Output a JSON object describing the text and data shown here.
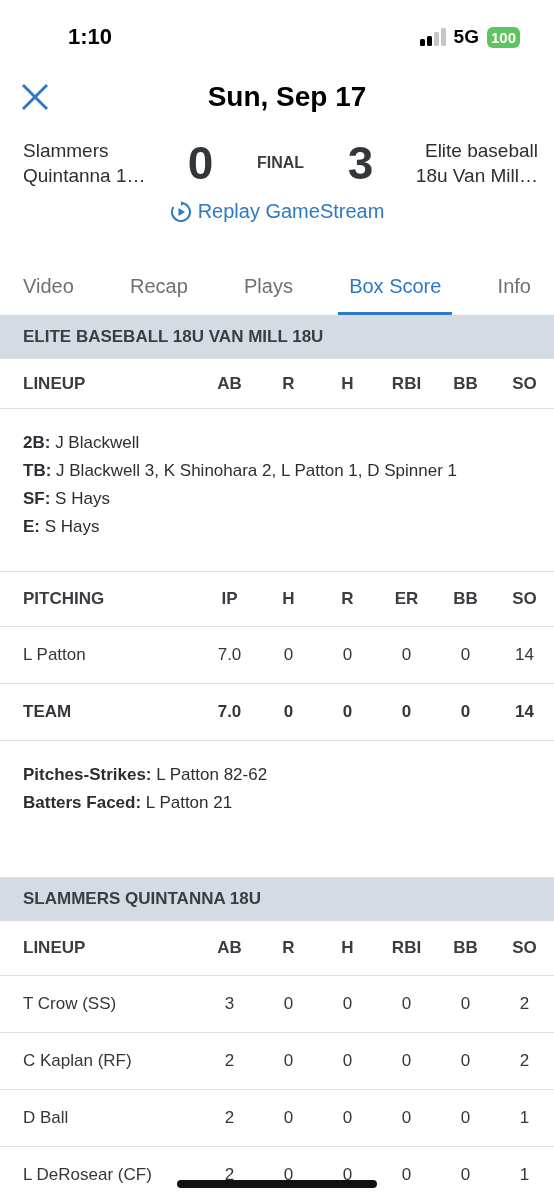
{
  "status_bar": {
    "time": "1:10",
    "network": "5G",
    "battery": "100"
  },
  "header": {
    "title": "Sun, Sep 17"
  },
  "scoreboard": {
    "away_name": [
      "Slammers",
      "Quintanna 1…"
    ],
    "away_score": "0",
    "status": "FINAL",
    "home_score": "3",
    "home_name": [
      "Elite baseball",
      "18u Van Mill…"
    ]
  },
  "replay_link": "Replay GameStream",
  "tabs": [
    {
      "label": "Video",
      "selected": false
    },
    {
      "label": "Recap",
      "selected": false
    },
    {
      "label": "Plays",
      "selected": false
    },
    {
      "label": "Box Score",
      "selected": true
    },
    {
      "label": "Info",
      "selected": false
    }
  ],
  "sections": [
    {
      "title": "ELITE BASEBALL 18U VAN MILL 18U",
      "blocks": [
        {
          "kind": "table",
          "columns": [
            "LINEUP",
            "AB",
            "R",
            "H",
            "RBI",
            "BB",
            "SO"
          ]
        },
        {
          "kind": "notes",
          "lines": [
            "**2B:** J Blackwell",
            "**TB:** J Blackwell 3, K Shinohara 2, L Patton 1, D Spinner 1",
            "**SF:** S Hays",
            "**E:** S Hays"
          ]
        },
        {
          "kind": "table",
          "columns": [
            "PITCHING",
            "IP",
            "H",
            "R",
            "ER",
            "BB",
            "SO"
          ],
          "rows": [
            {
              "total": false,
              "cells": [
                "L Patton",
                "7.0",
                "0",
                "0",
                "0",
                "0",
                "14"
              ]
            },
            {
              "total": true,
              "cells": [
                "TEAM",
                "7.0",
                "0",
                "0",
                "0",
                "0",
                "14"
              ]
            }
          ]
        },
        {
          "kind": "notes",
          "lines": [
            "**Pitches-Strikes:** L Patton 82-62",
            "**Batters Faced:** L Patton 21"
          ]
        }
      ]
    },
    {
      "title": "SLAMMERS QUINTANNA 18U",
      "blocks": [
        {
          "kind": "table",
          "columns": [
            "LINEUP",
            "AB",
            "R",
            "H",
            "RBI",
            "BB",
            "SO"
          ],
          "rows": [
            {
              "total": false,
              "cells": [
                "T Crow (SS)",
                "3",
                "0",
                "0",
                "0",
                "0",
                "2"
              ]
            },
            {
              "total": false,
              "cells": [
                "C Kaplan (RF)",
                "2",
                "0",
                "0",
                "0",
                "0",
                "2"
              ]
            },
            {
              "total": false,
              "cells": [
                "D Ball",
                "2",
                "0",
                "0",
                "0",
                "0",
                "1"
              ]
            },
            {
              "total": false,
              "cells": [
                "L DeRosear (CF)",
                "2",
                "0",
                "0",
                "0",
                "0",
                "1"
              ]
            }
          ]
        }
      ]
    }
  ]
}
